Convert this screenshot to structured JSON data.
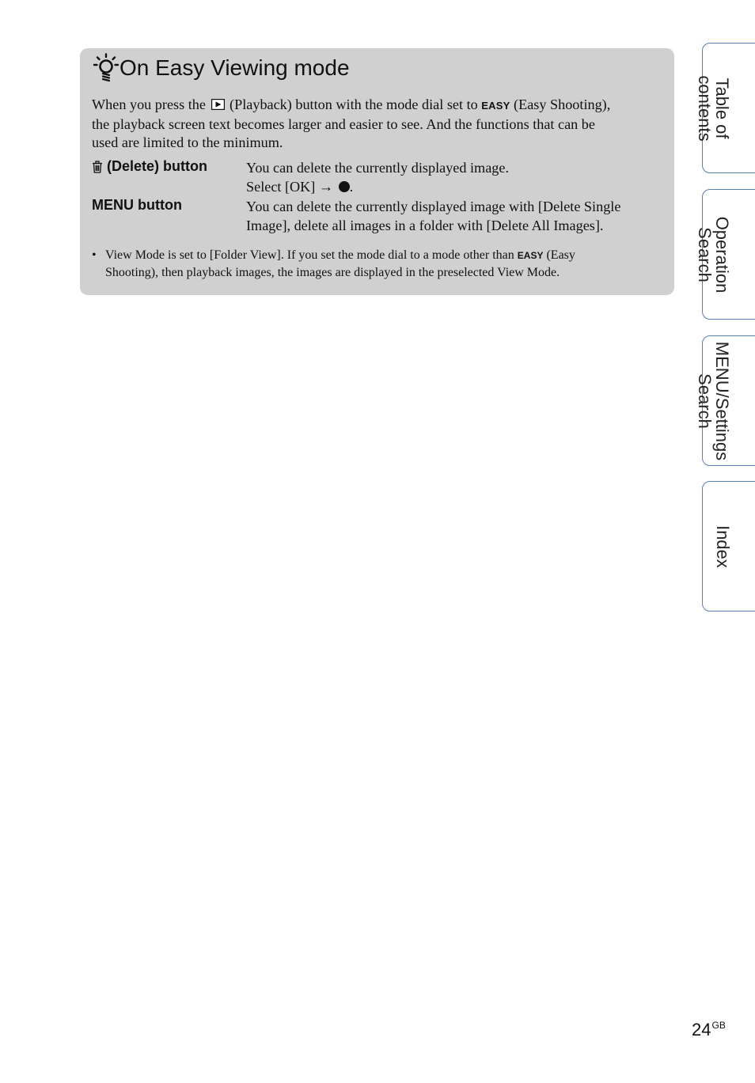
{
  "tip": {
    "title": "On Easy Viewing mode",
    "intro": {
      "part1": "When you press the",
      "part2": "(Playback) button with the mode dial set to",
      "easy": "EASY",
      "part3": "(Easy Shooting),",
      "line2": "the playback screen text becomes larger and easier to see. And the functions that can be",
      "line3": "used are limited to the minimum."
    },
    "rows": [
      {
        "label": "(Delete) button",
        "desc_line1": "You can delete the currently displayed image.",
        "desc_line2": "Select [OK] →"
      },
      {
        "label": "MENU button",
        "desc_line1": "You can delete the currently displayed image with [Delete Single",
        "desc_line2": "Image], delete all images in a folder with [Delete All Images]."
      }
    ],
    "note": {
      "bullet": "•",
      "part1": "View Mode is set to [Folder View]. If you set the mode dial to a mode other than",
      "easy": "EASY",
      "part2": "(Easy",
      "line2": "Shooting), then playback images, the images are displayed in the preselected View Mode."
    }
  },
  "side_tabs": [
    {
      "line1": "Table of",
      "line2": "contents"
    },
    {
      "line1": "Operation",
      "line2": "Search"
    },
    {
      "line1": "MENU/Settings",
      "line2": "Search"
    },
    {
      "line1": "Index",
      "line2": ""
    }
  ],
  "page": {
    "number": "24",
    "suffix": "GB"
  },
  "icons": {
    "hint": "hint-bulb-icon",
    "playback": "playback-icon",
    "delete": "trash-icon",
    "confirm": "center-button-dot-icon"
  },
  "colors": {
    "tip_background": "#d0d0d0",
    "tab_border": "#5b7fae"
  }
}
